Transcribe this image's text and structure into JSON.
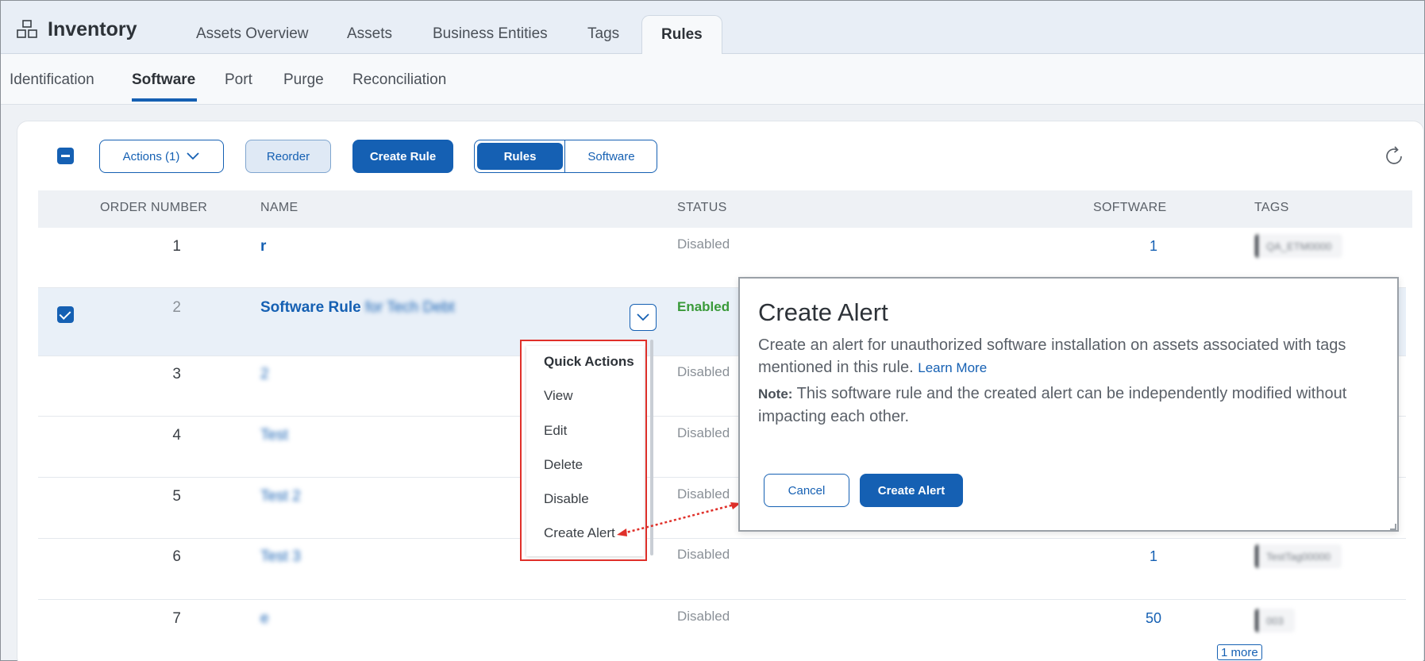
{
  "app": {
    "title": "Inventory",
    "icon": "inventory-icon"
  },
  "top_tabs": [
    {
      "label": "Assets Overview",
      "active": false
    },
    {
      "label": "Assets",
      "active": false
    },
    {
      "label": "Business Entities",
      "active": false
    },
    {
      "label": "Tags",
      "active": false
    },
    {
      "label": "Rules",
      "active": true
    }
  ],
  "sub_tabs": [
    {
      "label": "Identification",
      "active": false
    },
    {
      "label": "Software",
      "active": true
    },
    {
      "label": "Port",
      "active": false
    },
    {
      "label": "Purge",
      "active": false
    },
    {
      "label": "Reconciliation",
      "active": false
    }
  ],
  "toolbar": {
    "actions_label": "Actions (1)",
    "reorder_label": "Reorder",
    "create_rule_label": "Create Rule",
    "view_toggle": {
      "options": [
        "Rules",
        "Software"
      ],
      "selected": "Rules"
    }
  },
  "table": {
    "columns": [
      "ORDER NUMBER",
      "NAME",
      "STATUS",
      "SOFTWARE",
      "TAGS"
    ],
    "rows": [
      {
        "order": "1",
        "name": "r",
        "name_extra": "",
        "status": "Disabled",
        "software": "1",
        "tag": "QA_ETM0000",
        "selected": false
      },
      {
        "order": "2",
        "name": "Software Rule",
        "name_extra": "for Tech Debt",
        "status": "Enabled",
        "software": "",
        "tag": "",
        "selected": true
      },
      {
        "order": "3",
        "name": "2",
        "name_extra": "",
        "status": "Disabled",
        "software": "",
        "tag": "",
        "selected": false
      },
      {
        "order": "4",
        "name": "Test",
        "name_extra": "",
        "status": "Disabled",
        "software": "",
        "tag": "",
        "selected": false
      },
      {
        "order": "5",
        "name": "Test 2",
        "name_extra": "",
        "status": "Disabled",
        "software": "",
        "tag": "",
        "selected": false
      },
      {
        "order": "6",
        "name": "Test 3",
        "name_extra": "",
        "status": "Disabled",
        "software": "1",
        "tag": "TestTag00000",
        "selected": false
      },
      {
        "order": "7",
        "name": "e",
        "name_extra": "",
        "status": "Disabled",
        "software": "50",
        "tag": "003",
        "selected": false,
        "more": "1 more"
      }
    ]
  },
  "quick_actions": {
    "title": "Quick Actions",
    "items": [
      "View",
      "Edit",
      "Delete",
      "Disable",
      "Create Alert"
    ]
  },
  "dialog": {
    "title": "Create Alert",
    "body": "Create an alert for unauthorized software installation on assets associated with tags mentioned in this rule.",
    "learn_more": "Learn More",
    "note_label": "Note:",
    "note": "This software rule and the created alert can be independently modified without impacting each other.",
    "cancel_label": "Cancel",
    "confirm_label": "Create Alert"
  },
  "colors": {
    "accent": "#1560b3",
    "enabled": "#3a9a3a",
    "highlight": "#e0302a"
  }
}
